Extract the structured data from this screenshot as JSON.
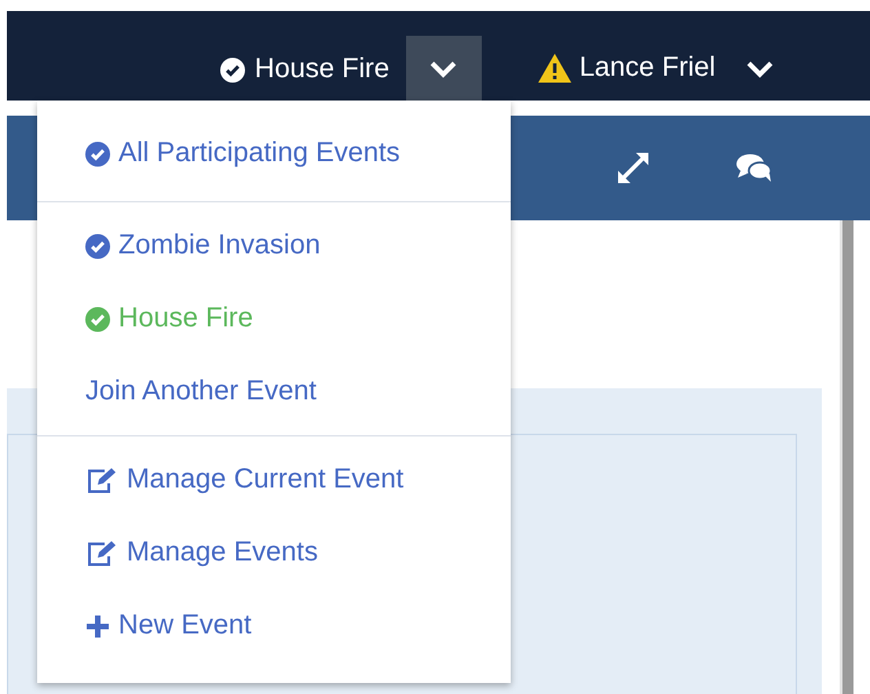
{
  "top_bar": {
    "current_event": {
      "label": "House Fire"
    },
    "event_menu_toggle": {
      "expanded": true
    },
    "user": {
      "name": "Lance Friel",
      "warning": true
    }
  },
  "event_menu": {
    "groups": [
      [
        {
          "kind": "check",
          "label": "All Participating Events",
          "selected": false
        }
      ],
      [
        {
          "kind": "check",
          "label": "Zombie Invasion",
          "selected": false
        },
        {
          "kind": "check",
          "label": "House Fire",
          "selected": true
        },
        {
          "kind": "plain",
          "label": "Join Another Event",
          "selected": false
        }
      ],
      [
        {
          "kind": "edit",
          "label": "Manage Current Event",
          "selected": false
        },
        {
          "kind": "edit",
          "label": "Manage Events",
          "selected": false
        },
        {
          "kind": "plus",
          "label": "New Event",
          "selected": false
        }
      ]
    ]
  }
}
